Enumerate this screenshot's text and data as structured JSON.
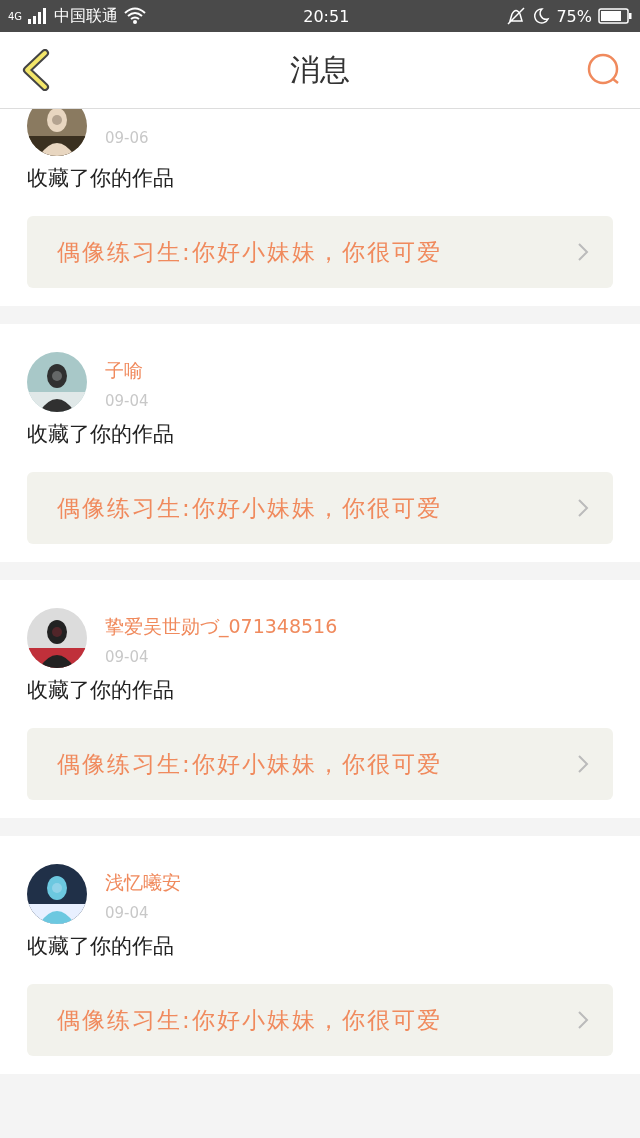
{
  "status_bar": {
    "network": "4G",
    "carrier": "中国联通",
    "time": "20:51",
    "battery": "75%"
  },
  "header": {
    "title": "消息"
  },
  "messages": [
    {
      "date": "09-06",
      "action": "收藏了你的作品",
      "quote": "偶像练习生:你好小妹妹，你很可爱"
    },
    {
      "name": "子喻",
      "date": "09-04",
      "action": "收藏了你的作品",
      "quote": "偶像练习生:你好小妹妹，你很可爱"
    },
    {
      "name": "挚爱吴世勋づ_071348516",
      "date": "09-04",
      "action": "收藏了你的作品",
      "quote": "偶像练习生:你好小妹妹，你很可爱"
    },
    {
      "name": "浅忆曦安",
      "date": "09-04",
      "action": "收藏了你的作品",
      "quote": "偶像练习生:你好小妹妹，你很可爱"
    }
  ]
}
